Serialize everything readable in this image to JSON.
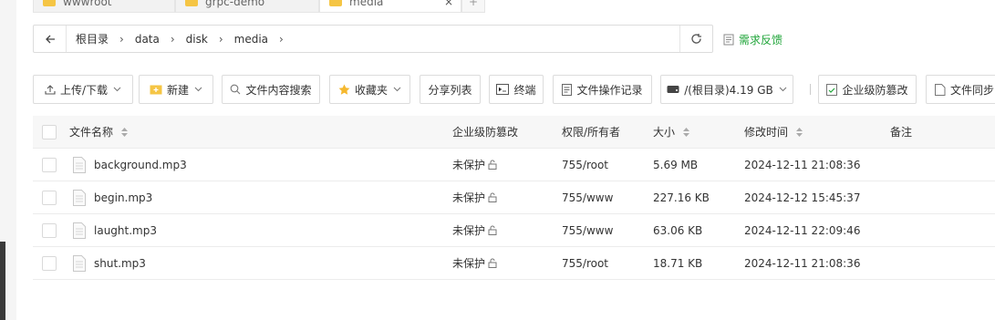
{
  "tabs": [
    {
      "label": "wwwroot"
    },
    {
      "label": "grpc-demo"
    },
    {
      "label": "media",
      "close": "×"
    },
    {
      "label": "+"
    }
  ],
  "breadcrumb": [
    "根目录",
    "data",
    "disk",
    "media"
  ],
  "feedback_label": "需求反馈",
  "toolbar": {
    "upload": "上传/下载",
    "new": "新建",
    "search": "文件内容搜索",
    "favorites": "收藏夹",
    "share": "分享列表",
    "terminal": "终端",
    "oplog": "文件操作记录",
    "disk": "/(根目录)4.19 GB",
    "tamper": "企业级防篡改",
    "sync": "文件同步"
  },
  "table": {
    "headers": {
      "name": "文件名称",
      "protection": "企业级防篡改",
      "permission": "权限/所有者",
      "size": "大小",
      "mtime": "修改时间",
      "note": "备注"
    },
    "rows": [
      {
        "name": "background.mp3",
        "protection": "未保护",
        "permission": "755/root",
        "size": "5.69 MB",
        "mtime": "2024-12-11 21:08:36"
      },
      {
        "name": "begin.mp3",
        "protection": "未保护",
        "permission": "755/www",
        "size": "227.16 KB",
        "mtime": "2024-12-12 15:45:37"
      },
      {
        "name": "laught.mp3",
        "protection": "未保护",
        "permission": "755/www",
        "size": "63.06 KB",
        "mtime": "2024-12-11 22:09:46"
      },
      {
        "name": "shut.mp3",
        "protection": "未保护",
        "permission": "755/root",
        "size": "18.71 KB",
        "mtime": "2024-12-11 21:08:36"
      }
    ]
  },
  "colors": {
    "accent": "#20a53a",
    "folder": "#f5c544"
  }
}
